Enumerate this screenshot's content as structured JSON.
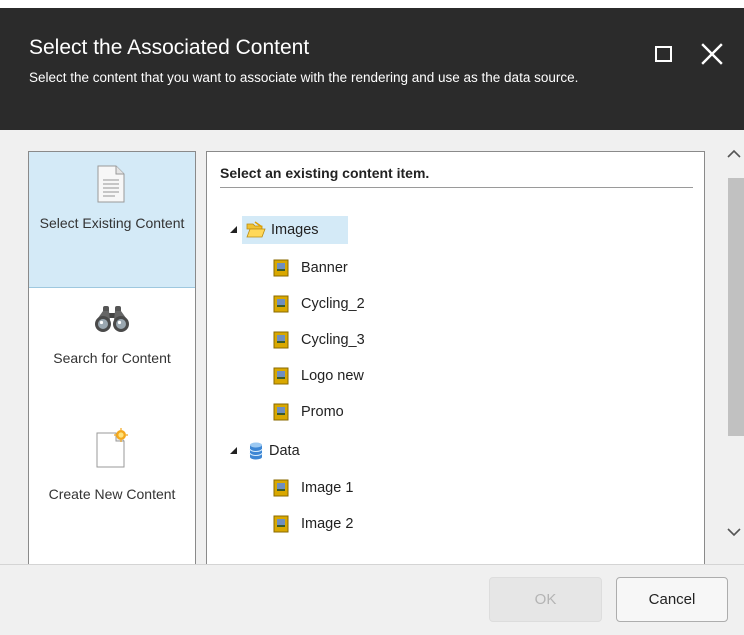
{
  "dialog": {
    "title": "Select the Associated Content",
    "subtitle": "Select the content that you want to associate with the rendering and use as the data source."
  },
  "nav": {
    "items": [
      {
        "label": "Select Existing Content",
        "icon": "document-icon",
        "active": true
      },
      {
        "label": "Search for Content",
        "icon": "binoculars-icon",
        "active": false
      },
      {
        "label": "Create New Content",
        "icon": "new-document-icon",
        "active": false
      }
    ]
  },
  "content": {
    "heading": "Select an existing content item.",
    "tree": [
      {
        "label": "Images",
        "icon": "open-folder-icon",
        "expanded": true,
        "selected": true,
        "children": [
          "Banner",
          "Cycling_2",
          "Cycling_3",
          "Logo new",
          "Promo"
        ]
      },
      {
        "label": "Data",
        "icon": "database-icon",
        "expanded": true,
        "selected": false,
        "children": [
          "Image 1",
          "Image 2"
        ]
      }
    ]
  },
  "buttons": {
    "ok": "OK",
    "cancel": "Cancel"
  },
  "colors": {
    "header_bg": "#2b2b2b",
    "selection_bg": "#d4eaf7",
    "body_bg": "#f0f0f0"
  }
}
